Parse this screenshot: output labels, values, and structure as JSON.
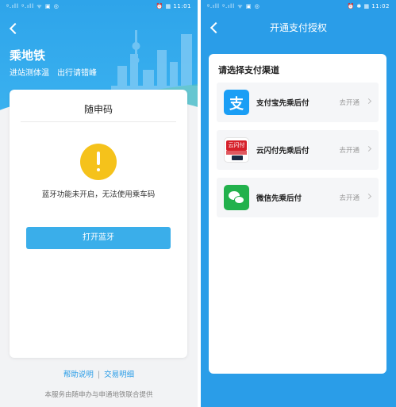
{
  "left_screen": {
    "status_bar": {
      "left": "ᵍ.ıll ᵍ.ıll ᯤ ▣ ◎",
      "right": "⏰ ▦ 11:01"
    },
    "header": {
      "title": "乘地铁",
      "subtitle": "进站测体温　出行请错峰"
    },
    "card": {
      "title": "随申码",
      "warning_text": "蓝牙功能未开启，无法使用乘车码",
      "button_label": "打开蓝牙"
    },
    "footer": {
      "help_link": "帮助说明",
      "separator": "|",
      "transactions_link": "交易明细",
      "note": "本服务由随申办与申通地铁联合提供"
    }
  },
  "right_screen": {
    "status_bar": {
      "left": "ᵍ.ıll ᵍ.ıll ᯤ ▣ ◎",
      "right": "⏰ ✱ ▦ 11:02"
    },
    "nav": {
      "title": "开通支付授权"
    },
    "card": {
      "heading": "请选择支付渠道",
      "channels": [
        {
          "label": "支付宝先乘后付",
          "action": "去开通",
          "icon": "alipay-icon",
          "icon_glyph": "支"
        },
        {
          "label": "云闪付先乘后付",
          "action": "去开通",
          "icon": "unionpay-icon",
          "icon_glyph": "云闪付"
        },
        {
          "label": "微信先乘后付",
          "action": "去开通",
          "icon": "wechat-icon"
        }
      ]
    }
  },
  "colors": {
    "accent_blue": "#2a9de8",
    "button_blue": "#3aaeea",
    "warning_yellow": "#f5c21b",
    "alipay_blue": "#1a9ef5",
    "unionpay_red": "#d6202a",
    "wechat_green": "#22b14c"
  }
}
